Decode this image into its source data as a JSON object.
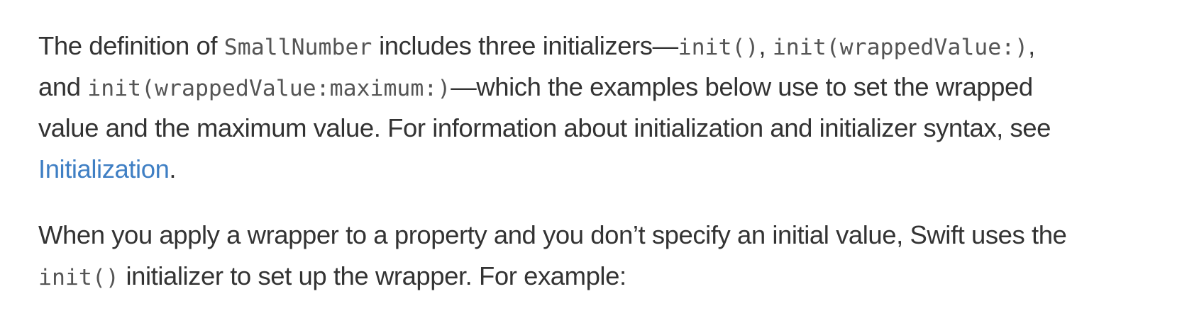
{
  "paragraph_1": {
    "line_1": {
      "t1": "The definition of ",
      "c1": "SmallNumber",
      "t2": " includes three initializers—",
      "c2": "init()",
      "t3": ", ",
      "c3": "init(wrappedValue:)",
      "t4": ","
    },
    "line_2": {
      "t1": "and ",
      "c1": "init(wrappedValue:maximum:)",
      "t2": "—which the examples below use to set the wrapped"
    },
    "line_3": {
      "t1": "value and the maximum value. For information about initialization and initializer syntax, see"
    },
    "line_4": {
      "link": "Initialization",
      "t1": "."
    }
  },
  "paragraph_2": {
    "line_1": {
      "t1": "When you apply a wrapper to a property and you don’t specify an initial value, Swift uses the"
    },
    "line_2": {
      "c1": "init()",
      "t1": " initializer to set up the wrapper. For example:"
    }
  },
  "colors": {
    "body_text": "#333333",
    "code_text": "#555555",
    "link": "#3f7fc4"
  }
}
